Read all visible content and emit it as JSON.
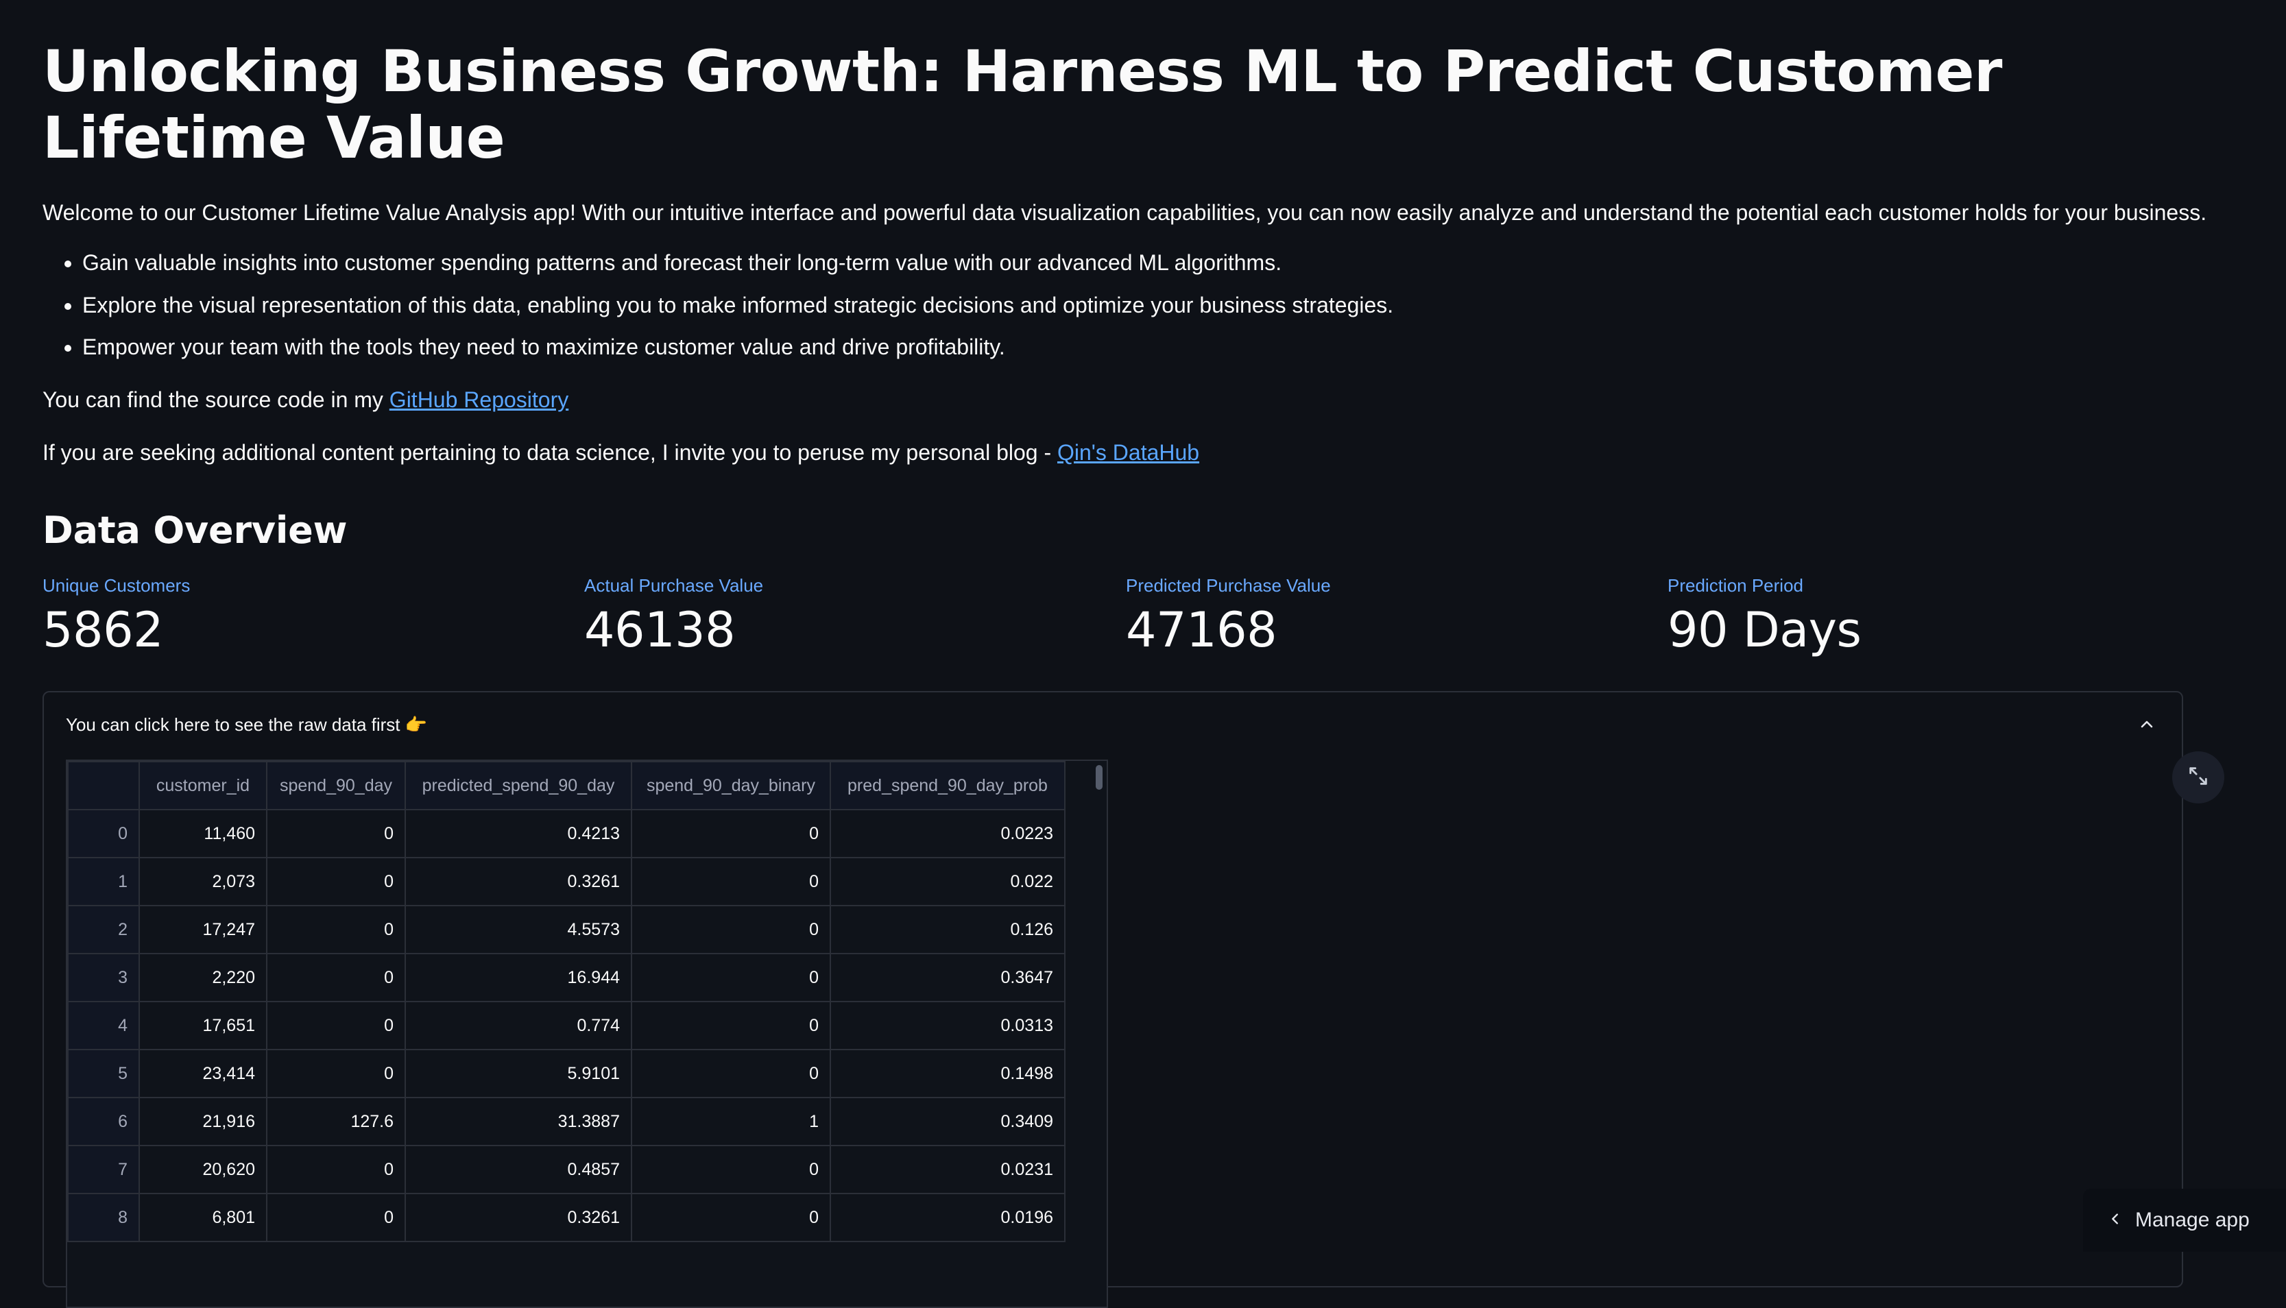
{
  "header": {
    "title": "Unlocking Business Growth: Harness ML to Predict Customer Lifetime Value"
  },
  "intro": {
    "text": "Welcome to our Customer Lifetime Value Analysis app! With our intuitive interface and powerful data visualization capabilities, you can now easily analyze and understand the potential each customer holds for your business."
  },
  "bullets": [
    "Gain valuable insights into customer spending patterns and forecast their long-term value with our advanced ML algorithms.",
    "Explore the visual representation of this data, enabling you to make informed strategic decisions and optimize your business strategies.",
    "Empower your team with the tools they need to maximize customer value and drive profitability."
  ],
  "source": {
    "prefix": "You can find the source code in my ",
    "link_label": "GitHub Repository"
  },
  "blog": {
    "prefix": "If you are seeking additional content pertaining to data science, I invite you to peruse my personal blog - ",
    "link_label": "Qin's DataHub"
  },
  "overview": {
    "title": "Data Overview",
    "metrics": [
      {
        "label": "Unique Customers",
        "value": "5862"
      },
      {
        "label": "Actual Purchase Value",
        "value": "46138"
      },
      {
        "label": "Predicted Purchase Value",
        "value": "47168"
      },
      {
        "label": "Prediction Period",
        "value": "90 Days"
      }
    ]
  },
  "expander": {
    "label": "You can click here to see the raw data first 👉"
  },
  "table": {
    "columns": [
      "",
      "customer_id",
      "spend_90_day",
      "predicted_spend_90_day",
      "spend_90_day_binary",
      "pred_spend_90_day_prob"
    ],
    "rows": [
      [
        "0",
        "11,460",
        "0",
        "0.4213",
        "0",
        "0.0223"
      ],
      [
        "1",
        "2,073",
        "0",
        "0.3261",
        "0",
        "0.022"
      ],
      [
        "2",
        "17,247",
        "0",
        "4.5573",
        "0",
        "0.126"
      ],
      [
        "3",
        "2,220",
        "0",
        "16.944",
        "0",
        "0.3647"
      ],
      [
        "4",
        "17,651",
        "0",
        "0.774",
        "0",
        "0.0313"
      ],
      [
        "5",
        "23,414",
        "0",
        "5.9101",
        "0",
        "0.1498"
      ],
      [
        "6",
        "21,916",
        "127.6",
        "31.3887",
        "1",
        "0.3409"
      ],
      [
        "7",
        "20,620",
        "0",
        "0.4857",
        "0",
        "0.0231"
      ],
      [
        "8",
        "6,801",
        "0",
        "0.3261",
        "0",
        "0.0196"
      ]
    ]
  },
  "footer": {
    "manage_label": "Manage app"
  }
}
